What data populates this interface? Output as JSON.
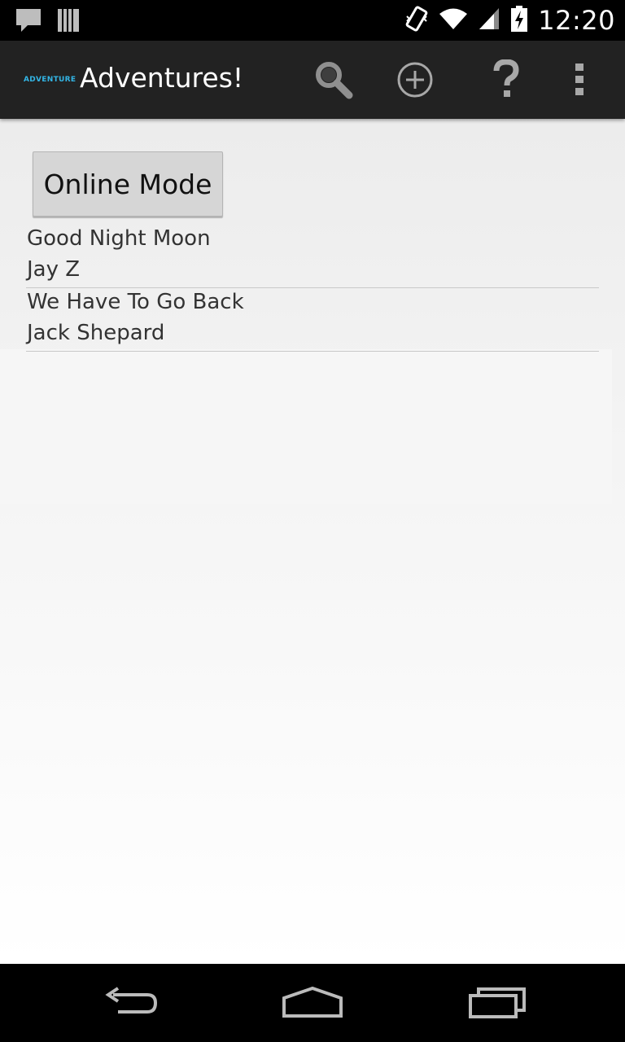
{
  "status_bar": {
    "time": "12:20",
    "icons": [
      "message-icon",
      "storage-icon",
      "vibrate-icon",
      "wifi-icon",
      "signal-icon",
      "battery-charging-icon"
    ]
  },
  "action_bar": {
    "logo_text": "ADVENTURE",
    "title": "Adventures!",
    "actions": [
      "search-icon",
      "add-icon",
      "help-icon",
      "overflow-menu-icon"
    ]
  },
  "main": {
    "online_button_label": "Online Mode",
    "adventures": [
      {
        "title": "Good Night Moon",
        "author": "Jay Z"
      },
      {
        "title": "We Have To Go Back",
        "author": "Jack Shepard"
      }
    ]
  },
  "nav_bar": {
    "buttons": [
      "back-icon",
      "home-icon",
      "recents-icon"
    ]
  },
  "colors": {
    "action_bar_bg": "#222222",
    "accent": "#33b5e5",
    "content_bg": "#ececec"
  }
}
